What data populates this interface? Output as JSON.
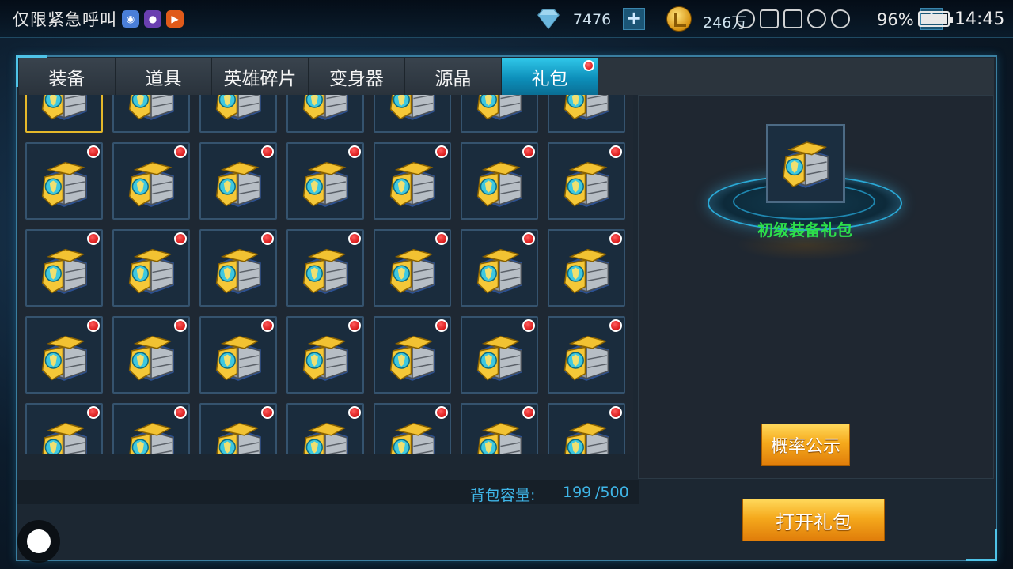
{
  "status_bar": {
    "carrier": "仅限紧急呼叫",
    "diamonds": "7476",
    "gold": "246万",
    "battery": "96%",
    "time": "14:45"
  },
  "tabs": [
    {
      "label": "装备",
      "active": false,
      "badge": false
    },
    {
      "label": "道具",
      "active": false,
      "badge": false
    },
    {
      "label": "英雄碎片",
      "active": false,
      "badge": false
    },
    {
      "label": "变身器",
      "active": false,
      "badge": false
    },
    {
      "label": "源晶",
      "active": false,
      "badge": false
    },
    {
      "label": "礼包",
      "active": true,
      "badge": true
    }
  ],
  "grid": {
    "columns": 7,
    "rows": 5,
    "selected_index": 0,
    "item_icon": "equipment-chest-icon"
  },
  "detail": {
    "item_name": "初级装备礼包",
    "name_color": "#2de04a"
  },
  "buttons": {
    "probability": "概率公示",
    "open_gift": "打开礼包"
  },
  "capacity": {
    "label": "背包容量:",
    "used": "199",
    "max": "/500"
  },
  "colors": {
    "tab_active": "#1aa9d3",
    "badge_red": "#d40000",
    "accent_gold": "#f5a91c",
    "capacity_text": "#3fb6e8"
  }
}
